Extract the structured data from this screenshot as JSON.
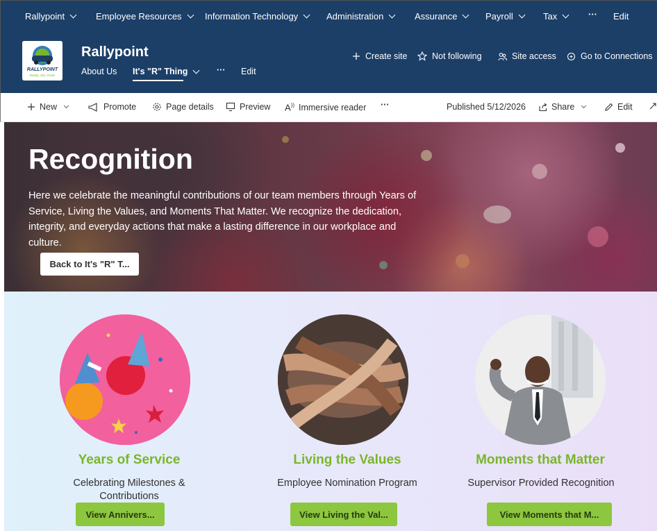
{
  "topnav": {
    "items": [
      {
        "label": "Rallypoint"
      },
      {
        "label": "Employee Resources"
      },
      {
        "label": "Information Technology"
      },
      {
        "label": "Administration"
      },
      {
        "label": "Assurance"
      },
      {
        "label": "Payroll"
      },
      {
        "label": "Tax"
      }
    ],
    "more": "···",
    "edit": "Edit"
  },
  "site": {
    "logo_text": "RALLYPOINT",
    "logo_tagline": "Ready. Set. Grow!",
    "title": "Rallypoint",
    "nav": [
      {
        "label": "About Us"
      },
      {
        "label": "It's \"R\" Thing"
      }
    ],
    "nav_more": "···",
    "nav_edit": "Edit",
    "actions": {
      "create_site": "Create site",
      "follow": "Not following",
      "access": "Site access",
      "connections": "Go to Connections"
    }
  },
  "commandbar": {
    "new": "New",
    "promote": "Promote",
    "page_details": "Page details",
    "preview": "Preview",
    "immersive_reader": "Immersive reader",
    "more": "···",
    "published": "Published 5/12/2026",
    "share": "Share",
    "edit": "Edit"
  },
  "hero": {
    "title": "Recognition",
    "text": "Here we celebrate the meaningful contributions of our team members through Years of Service, Living the Values, and Moments That Matter. We recognize the dedication, integrity, and everyday actions that make a lasting difference in our workplace and culture.",
    "button": "Back to It's \"R\" T..."
  },
  "cards": [
    {
      "title": "Years of Service",
      "desc": "Celebrating Milestones & Contributions",
      "button": "View Annivers..."
    },
    {
      "title": "Living the Values",
      "desc": "Employee Nomination Program",
      "button": "View Living the Val..."
    },
    {
      "title": "Moments that Matter",
      "desc": "Supervisor Provided Recognition",
      "button": "View Moments that M..."
    }
  ],
  "colors": {
    "header_bg": "#1c3f68",
    "accent_green": "#7ab62a",
    "button_green": "#8dc63f"
  }
}
